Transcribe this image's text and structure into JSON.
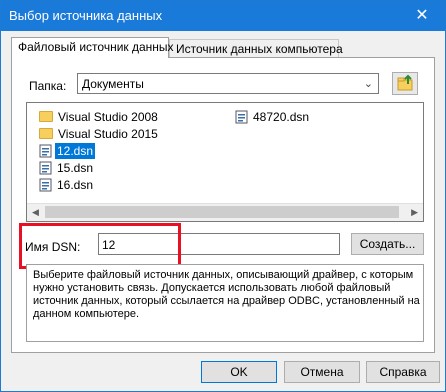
{
  "window": {
    "title": "Выбор источника данных",
    "close_symbol": "✕"
  },
  "tabs": [
    {
      "label": "Файловый источник данных"
    },
    {
      "label": "Источник данных компьютера"
    }
  ],
  "folder": {
    "label": "Папка:",
    "value": "Документы"
  },
  "files": [
    {
      "name": "Visual Studio 2008",
      "type": "folder",
      "icon": "folder-icon"
    },
    {
      "name": "Visual Studio 2015",
      "type": "folder",
      "icon": "folder-icon"
    },
    {
      "name": "12.dsn",
      "type": "dsn",
      "icon": "dsn-file-icon",
      "selected": true
    },
    {
      "name": "15.dsn",
      "type": "dsn",
      "icon": "dsn-file-icon"
    },
    {
      "name": "16.dsn",
      "type": "dsn",
      "icon": "dsn-file-icon"
    },
    {
      "name": "48720.dsn",
      "type": "dsn",
      "icon": "dsn-file-icon"
    }
  ],
  "dsn": {
    "label": "Имя DSN:",
    "value": "12",
    "create_label": "Создать..."
  },
  "description": [
    "Выберите файловый источник данных, описывающий драйвер, с которым",
    "нужно установить связь.  Допускается использовать любой файловый",
    "источник данных, который ссылается на драйвер ODBC, установленный на",
    "данном компьютере."
  ],
  "buttons": {
    "ok": "OK",
    "cancel": "Отмена",
    "help": "Справка"
  },
  "colors": {
    "titlebar": "#1a7ad9",
    "selection": "#0078d7",
    "highlight_box": "#e81123"
  }
}
